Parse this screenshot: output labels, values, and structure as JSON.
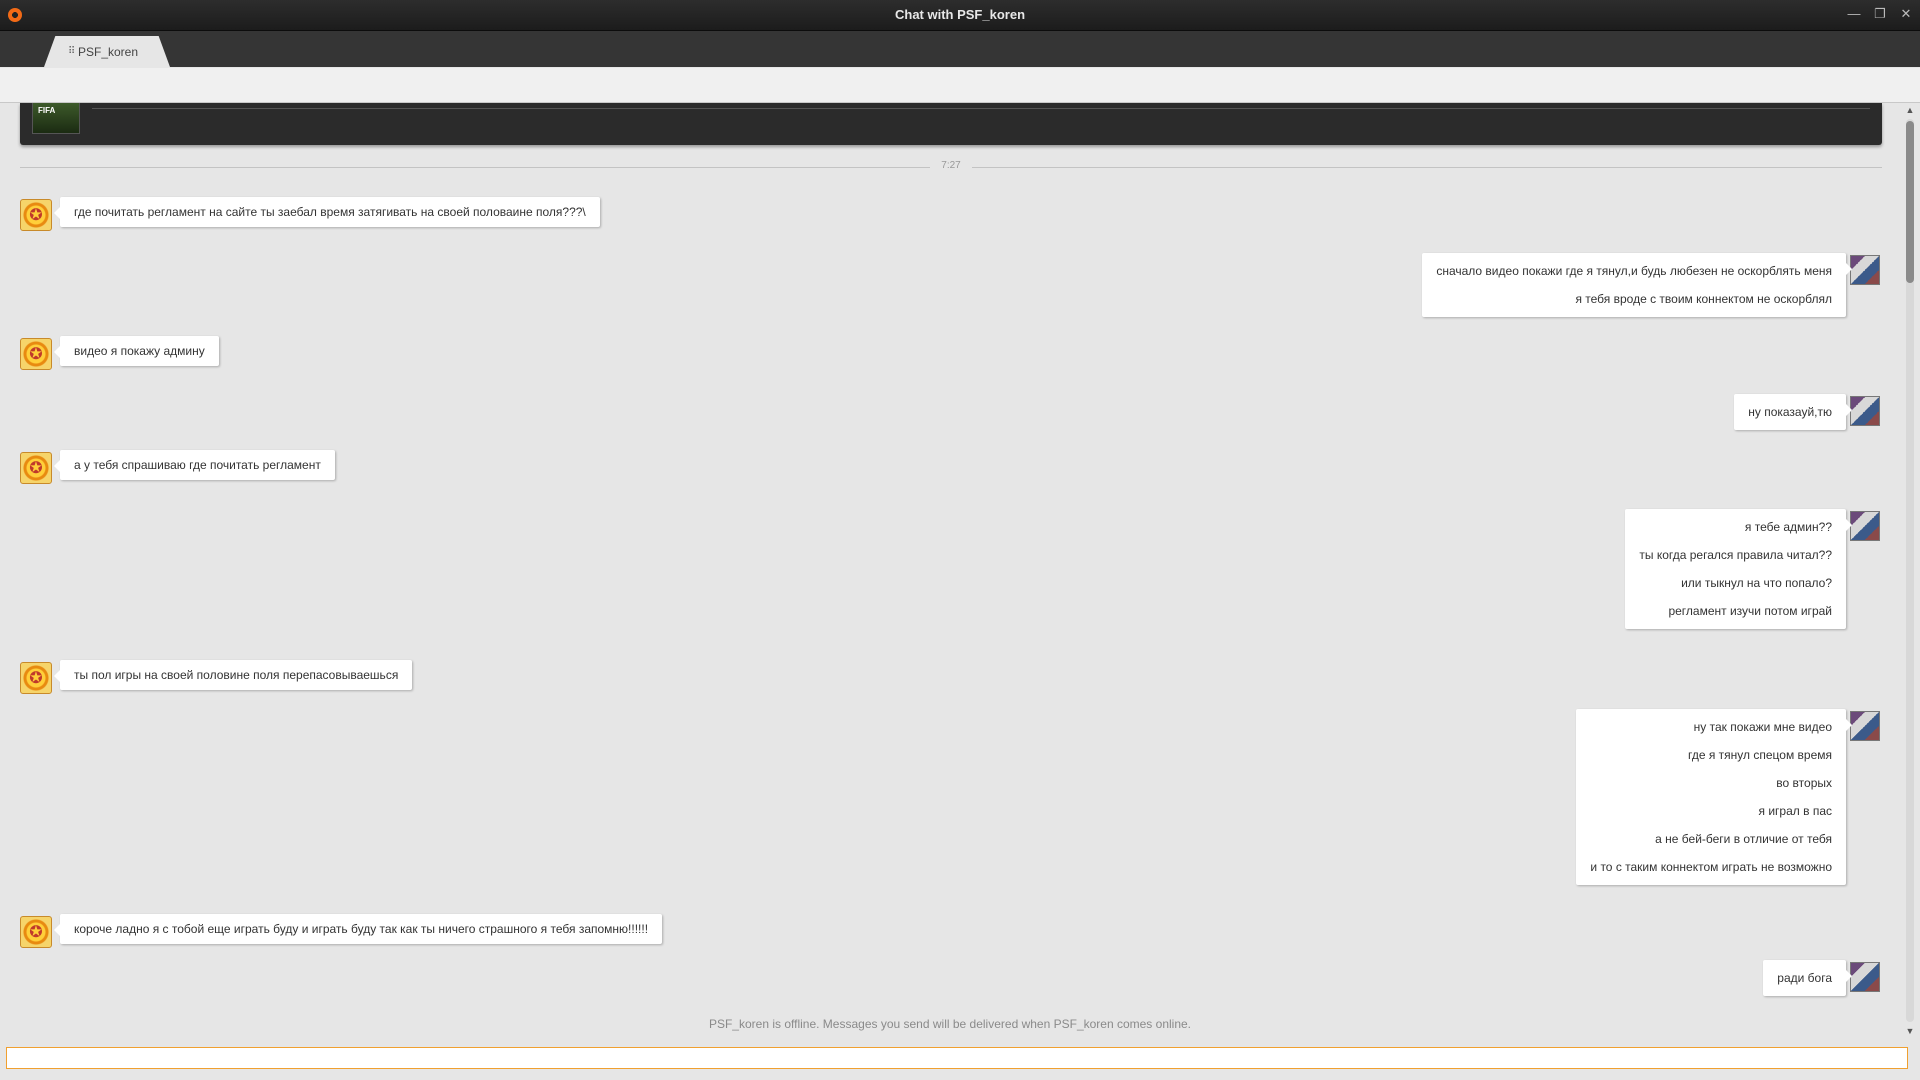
{
  "window": {
    "title": "Chat with PSF_koren",
    "controls": {
      "minimize": "—",
      "restore": "❐",
      "close": "✕"
    }
  },
  "tab": {
    "label": "PSF_koren",
    "grip": "⠿"
  },
  "profile": {
    "thumb_label": "FIFA"
  },
  "chat": {
    "time_separator": "7:27",
    "messages": [
      {
        "side": "left",
        "lines": [
          "где почитать регламент на сайте ты заебал время затягивать на своей половаине поля???\\"
        ]
      },
      {
        "side": "right",
        "lines": [
          "сначало видео покажи где я тянул,и будь любезен не оскорблять меня",
          "я тебя вроде с твоим коннектом не оскорблял"
        ]
      },
      {
        "side": "left",
        "lines": [
          "видео я покажу админу"
        ]
      },
      {
        "side": "right",
        "lines": [
          "ну показауй,тю"
        ]
      },
      {
        "side": "left",
        "lines": [
          "а у тебя спрашиваю где почитать регламент"
        ]
      },
      {
        "side": "right",
        "lines": [
          "я тебе админ??",
          "ты когда регался правила читал??",
          "или тыкнул на что попало?",
          "регламент изучи потом играй"
        ]
      },
      {
        "side": "left",
        "lines": [
          "ты пол игры на своей половине поля перепасовываешься"
        ]
      },
      {
        "side": "right",
        "lines": [
          "ну так покажи мне видео",
          "где я тянул спецом время",
          "во вторых",
          "я играл в пас",
          "а не бей-беги в отличие от тебя",
          "и то с таким коннектом играть не возможно"
        ]
      },
      {
        "side": "left",
        "lines": [
          "короче ладно я с тобой еще играть буду и играть буду так как ты ничего страшного я тебя запомню!!!!!!"
        ]
      },
      {
        "side": "right",
        "lines": [
          "ради бога"
        ]
      }
    ],
    "offline_note": "PSF_koren is offline. Messages you send will be delivered when PSF_koren comes online."
  },
  "scrollbar": {
    "up": "▲",
    "down": "▼"
  },
  "input": {
    "value": "",
    "placeholder": ""
  },
  "colors": {
    "accent": "#f26a16",
    "input_border": "#f0a030",
    "bubble": "#ffffff",
    "background": "#e6e6e6"
  }
}
